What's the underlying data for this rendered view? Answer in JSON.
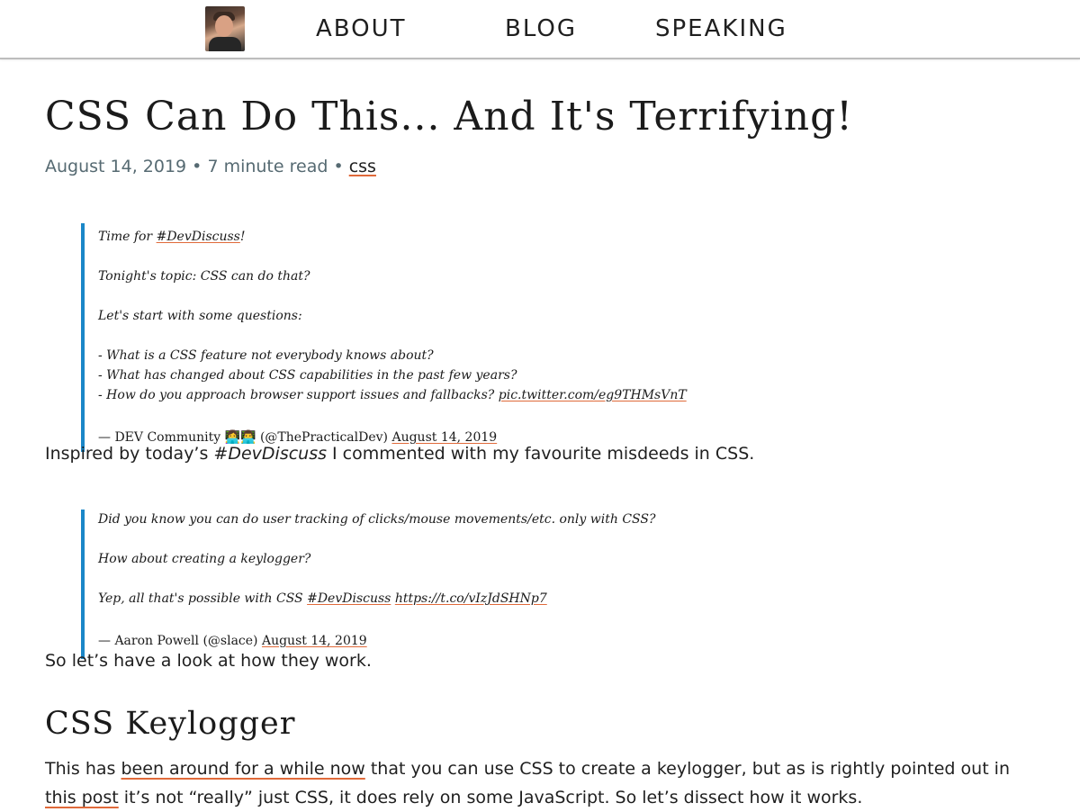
{
  "header": {
    "nav": {
      "about": "ABOUT",
      "blog": "BLOG",
      "speaking": "SPEAKING"
    }
  },
  "post": {
    "title": "CSS Can Do This... And It's Terrifying!",
    "meta": {
      "date": "August 14, 2019",
      "sep1": " • ",
      "read_time": "7 minute read",
      "sep2": " • ",
      "tag": "css"
    },
    "tweet1": {
      "line1_pre": "Time for ",
      "line1_link": "#DevDiscuss",
      "line1_post": "!",
      "line2": "Tonight's topic: CSS can do that?",
      "line3": "Let's start with some questions:",
      "line4": "- What is a CSS feature not everybody knows about?",
      "line5": "- What has changed about CSS capabilities in the past few years?",
      "line6_pre": "- How do you approach browser support issues and fallbacks? ",
      "line6_link": "pic.twitter.com/eg9THMsVnT",
      "attribution": "— DEV Community 👩‍💻👨‍💻 (@ThePracticalDev) ",
      "date_link": "August 14, 2019"
    },
    "para1_pre": "Inspired by today’s ",
    "para1_em": "#DevDiscuss",
    "para1_post": " I commented with my favourite misdeeds in CSS.",
    "tweet2": {
      "line1": "Did you know you can do user tracking of clicks/mouse movements/etc. only with CSS?",
      "line2": "How about creating a keylogger?",
      "line3_pre": "Yep, all that's possible with CSS ",
      "line3_link1": "#DevDiscuss",
      "line3_link2": "https://t.co/vIzJdSHNp7",
      "attribution": "— Aaron Powell (@slace) ",
      "date_link": "August 14, 2019"
    },
    "para2": "So let’s have a look at how they work.",
    "h2": "CSS Keylogger",
    "para3_pre": "This has ",
    "para3_link1": "been around for a while now",
    "para3_mid": " that you can use CSS to create a keylogger, but as is rightly pointed out in ",
    "para3_link2": "this post",
    "para3_post": " it’s not “really” just CSS, it does rely on some JavaScript. So let’s dissect how it works."
  },
  "colors": {
    "accent_underline": "#e06a3a",
    "blockquote_border": "#1a87c8",
    "meta_text": "#566a72"
  }
}
